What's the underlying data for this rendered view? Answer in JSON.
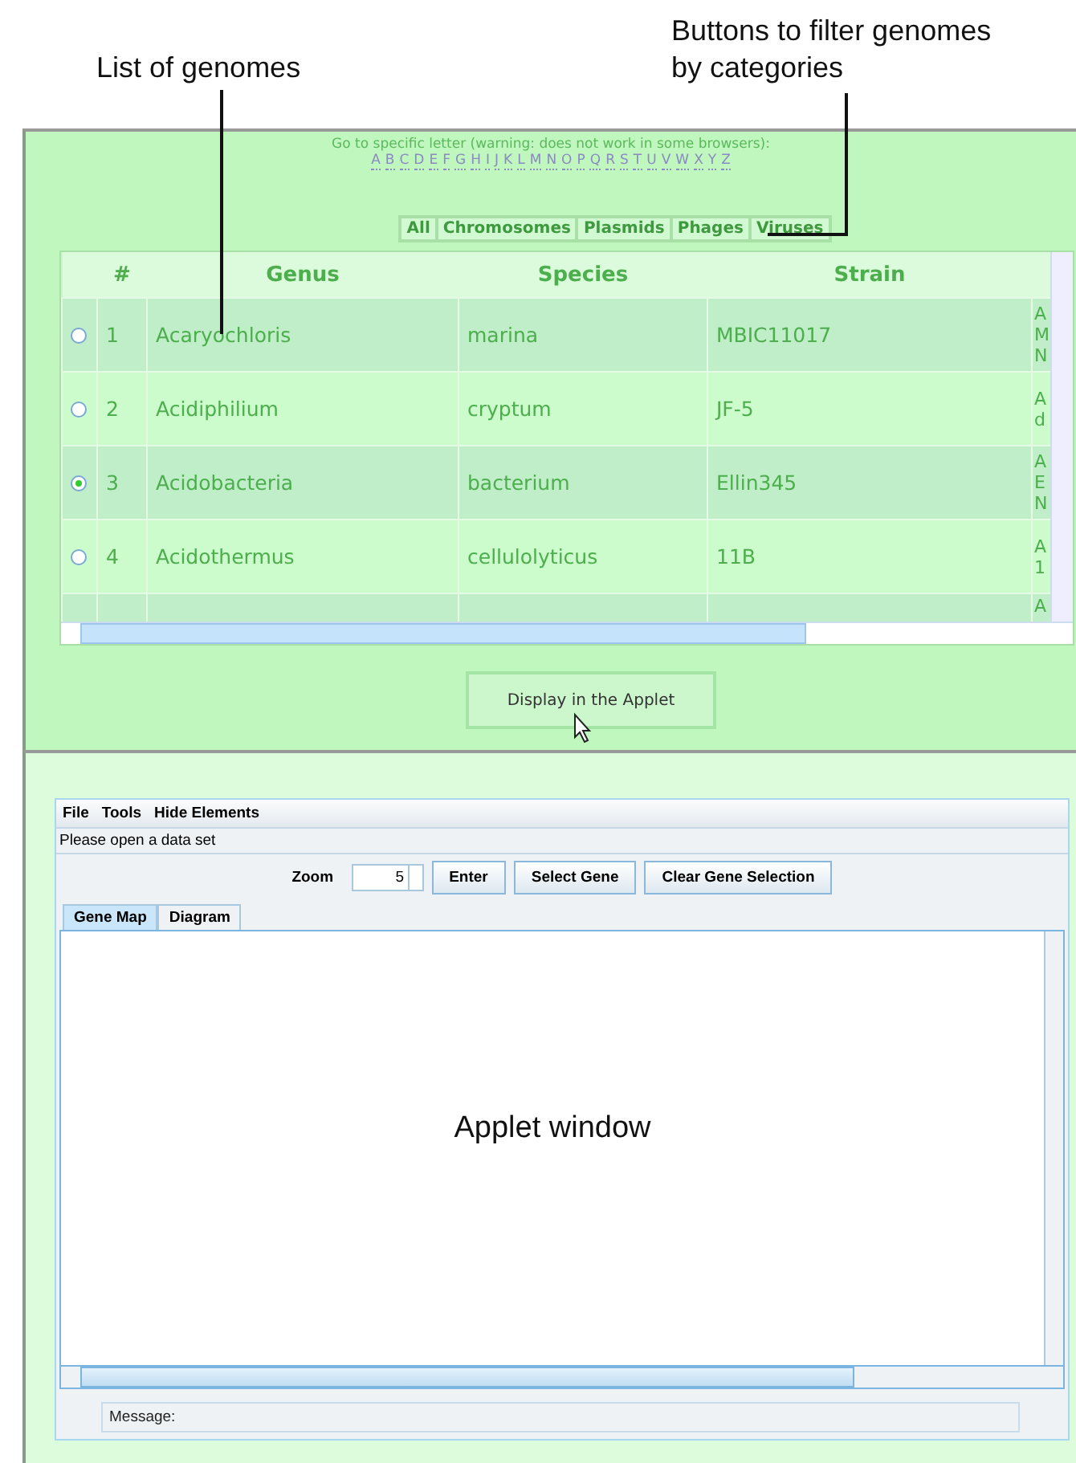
{
  "annotations": [
    {
      "text": "List of genomes"
    },
    {
      "text": "Buttons to filter genomes by categories"
    }
  ],
  "letter_nav": {
    "instruction": "Go to specific letter (warning: does not work in some browsers):",
    "letters": [
      "A",
      "B",
      "C",
      "D",
      "E",
      "F",
      "G",
      "H",
      "I",
      "J",
      "K",
      "L",
      "M",
      "N",
      "O",
      "P",
      "Q",
      "R",
      "S",
      "T",
      "U",
      "V",
      "W",
      "X",
      "Y",
      "Z"
    ]
  },
  "filters": [
    "All",
    "Chromosomes",
    "Plasmids",
    "Phages",
    "Viruses"
  ],
  "table": {
    "columns": [
      "#",
      "Genus",
      "Species",
      "Strain"
    ],
    "rows": [
      {
        "selected": false,
        "number": "1",
        "genus": "Acaryochloris",
        "species": "marina",
        "strain": "MBIC11017",
        "column_5": "A M N"
      },
      {
        "selected": false,
        "number": "2",
        "genus": "Acidiphilium",
        "species": "cryptum",
        "strain": "JF-5",
        "column_5": "A d"
      },
      {
        "selected": true,
        "number": "3",
        "genus": "Acidobacteria",
        "species": "bacterium",
        "strain": "Ellin345",
        "column_5": "A E N"
      },
      {
        "selected": false,
        "number": "4",
        "genus": "Acidothermus",
        "species": "cellulolyticus",
        "strain": "11B",
        "column_5": "A 1"
      },
      {
        "column_5": "A"
      }
    ]
  },
  "display_button": "Display in the Applet",
  "applet": {
    "menu": [
      "File",
      "Tools",
      "Hide Elements"
    ],
    "status": "Please open a data set",
    "zoom_label": "Zoom",
    "zoom_value": "5",
    "buttons": [
      "Enter",
      "Select Gene",
      "Clear Gene Selection"
    ],
    "tabs": [
      {
        "label": "Gene Map",
        "selected": true
      },
      {
        "label": "Diagram",
        "selected": false
      }
    ],
    "canvas_label": "Applet window",
    "message_label": "Message:"
  }
}
